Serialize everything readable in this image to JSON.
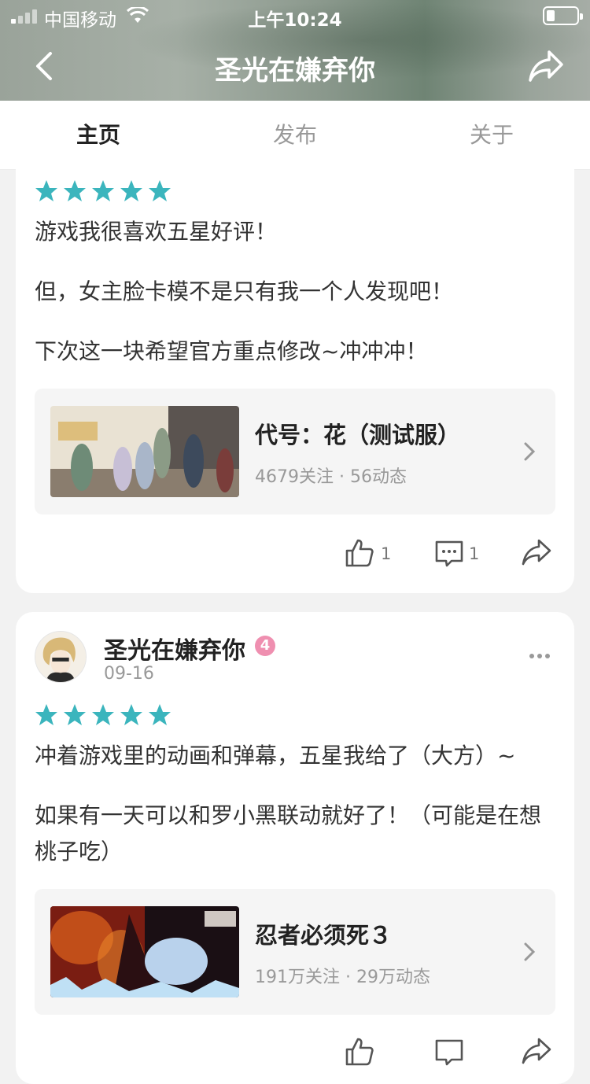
{
  "status_bar": {
    "carrier": "中国移动",
    "time": "上午10:24"
  },
  "nav": {
    "title": "圣光在嫌弃你"
  },
  "tabs": [
    {
      "label": "主页",
      "active": true
    },
    {
      "label": "发布",
      "active": false
    },
    {
      "label": "关于",
      "active": false
    }
  ],
  "posts": [
    {
      "rating": 5,
      "paragraphs": [
        "游戏我很喜欢五星好评！",
        "但，女主脸卡模不是只有我一个人发现吧！",
        "下次这一块希望官方重点修改~冲冲冲！"
      ],
      "game": {
        "name": "代号：花（测试服）",
        "meta": "4679关注 · 56动态"
      },
      "likes": "1",
      "comments": "1"
    },
    {
      "author": "圣光在嫌弃你",
      "level": "4",
      "date": "09-16",
      "rating": 5,
      "paragraphs": [
        "冲着游戏里的动画和弹幕，五星我给了（大方）~",
        "如果有一天可以和罗小黑联动就好了！（可能是在想桃子吃）"
      ],
      "game": {
        "name": "忍者必须死３",
        "meta": "191万关注 · 29万动态"
      }
    }
  ],
  "colors": {
    "accent": "#3bb5bd",
    "level_badge": "#ef8fb0"
  }
}
